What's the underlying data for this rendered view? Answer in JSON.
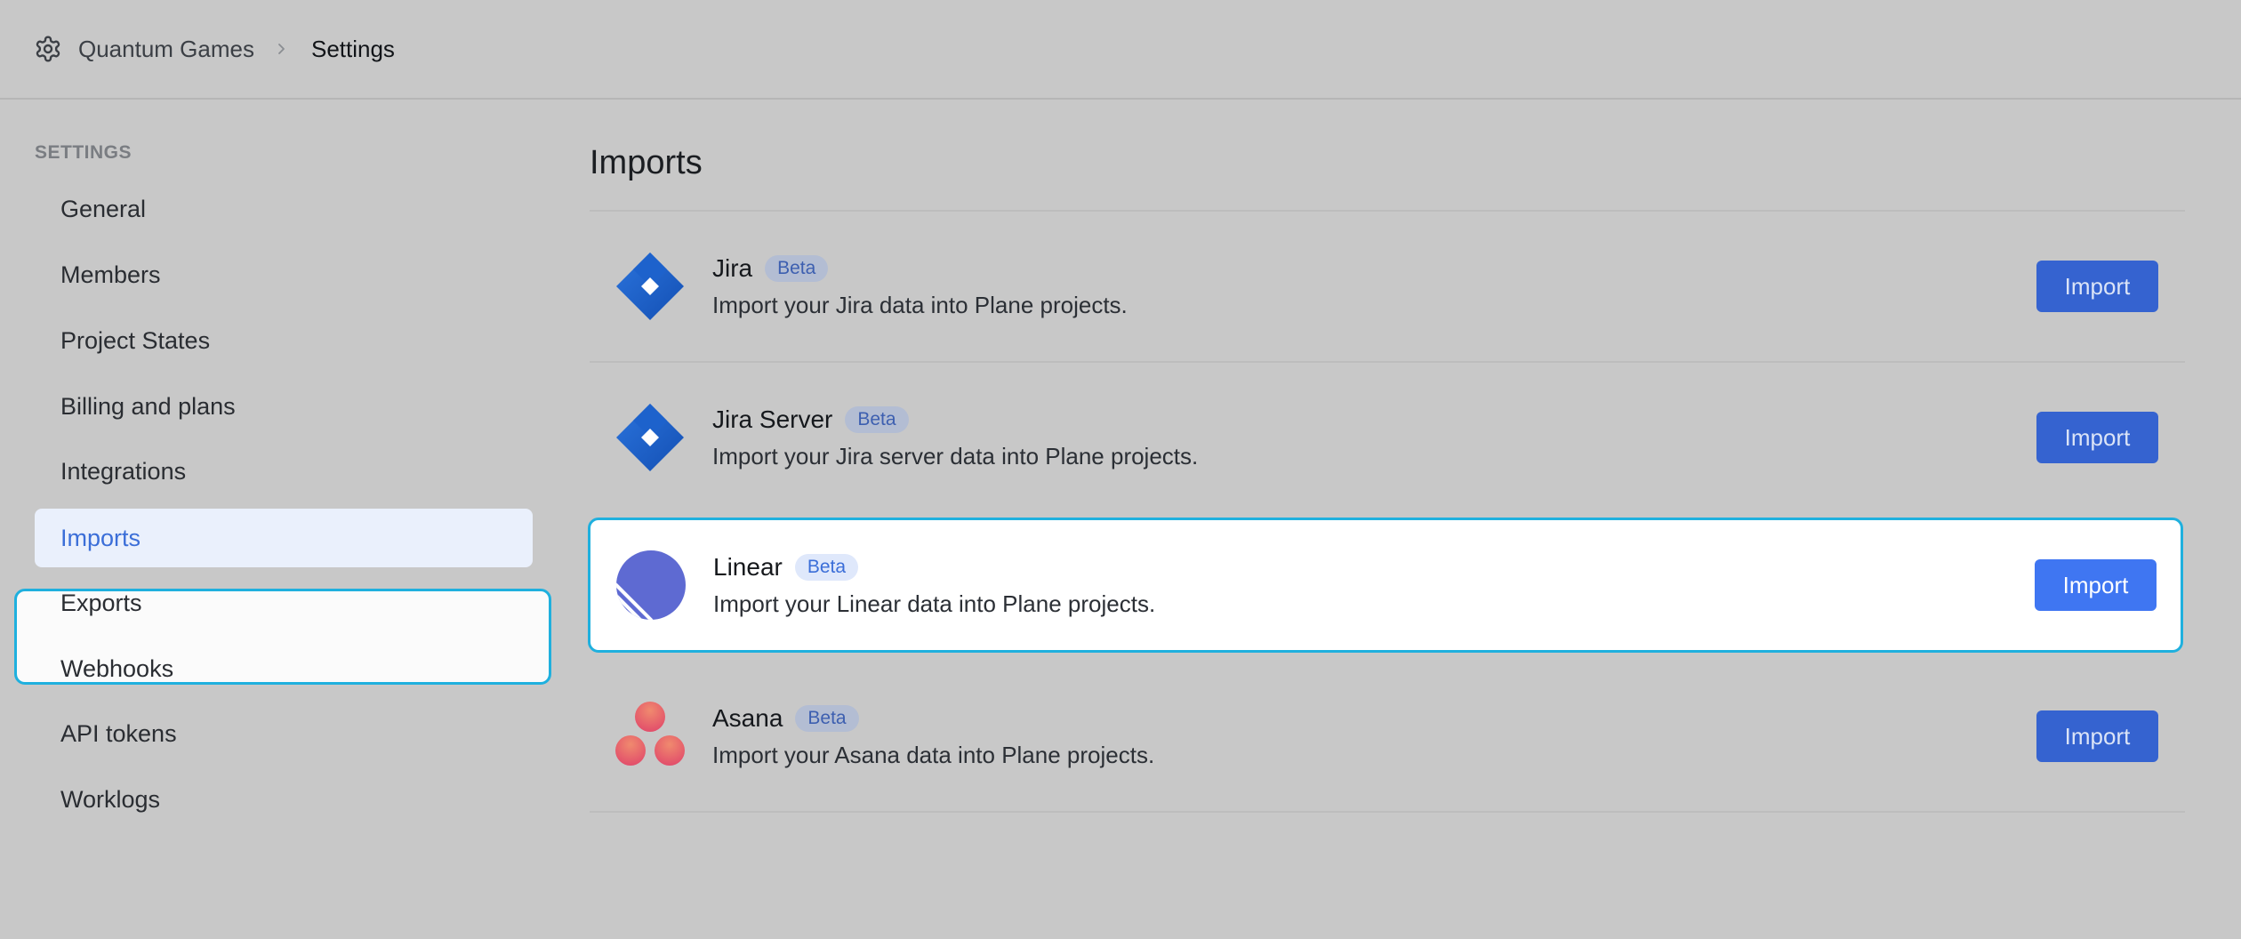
{
  "header": {
    "workspace": "Quantum Games",
    "current": "Settings"
  },
  "sidebar": {
    "heading": "SETTINGS",
    "items": [
      {
        "label": "General"
      },
      {
        "label": "Members"
      },
      {
        "label": "Project States"
      },
      {
        "label": "Billing and plans"
      },
      {
        "label": "Integrations"
      },
      {
        "label": "Imports",
        "active": true
      },
      {
        "label": "Exports"
      },
      {
        "label": "Webhooks"
      },
      {
        "label": "API tokens"
      },
      {
        "label": "Worklogs"
      }
    ]
  },
  "main": {
    "title": "Imports",
    "importers": [
      {
        "name": "Jira",
        "badge": "Beta",
        "description": "Import your Jira data into Plane projects.",
        "button": "Import",
        "icon": "jira-icon"
      },
      {
        "name": "Jira Server",
        "badge": "Beta",
        "description": "Import your Jira server data into Plane projects.",
        "button": "Import",
        "icon": "jira-icon"
      },
      {
        "name": "Linear",
        "badge": "Beta",
        "description": "Import your Linear data into Plane projects.",
        "button": "Import",
        "icon": "linear-icon"
      },
      {
        "name": "Asana",
        "badge": "Beta",
        "description": "Import your Asana data into Plane projects.",
        "button": "Import",
        "icon": "asana-icon"
      }
    ]
  },
  "colors": {
    "accent": "#3f76f2",
    "focus_ring": "#1fb0de",
    "overlay": "#c8c8c8"
  }
}
